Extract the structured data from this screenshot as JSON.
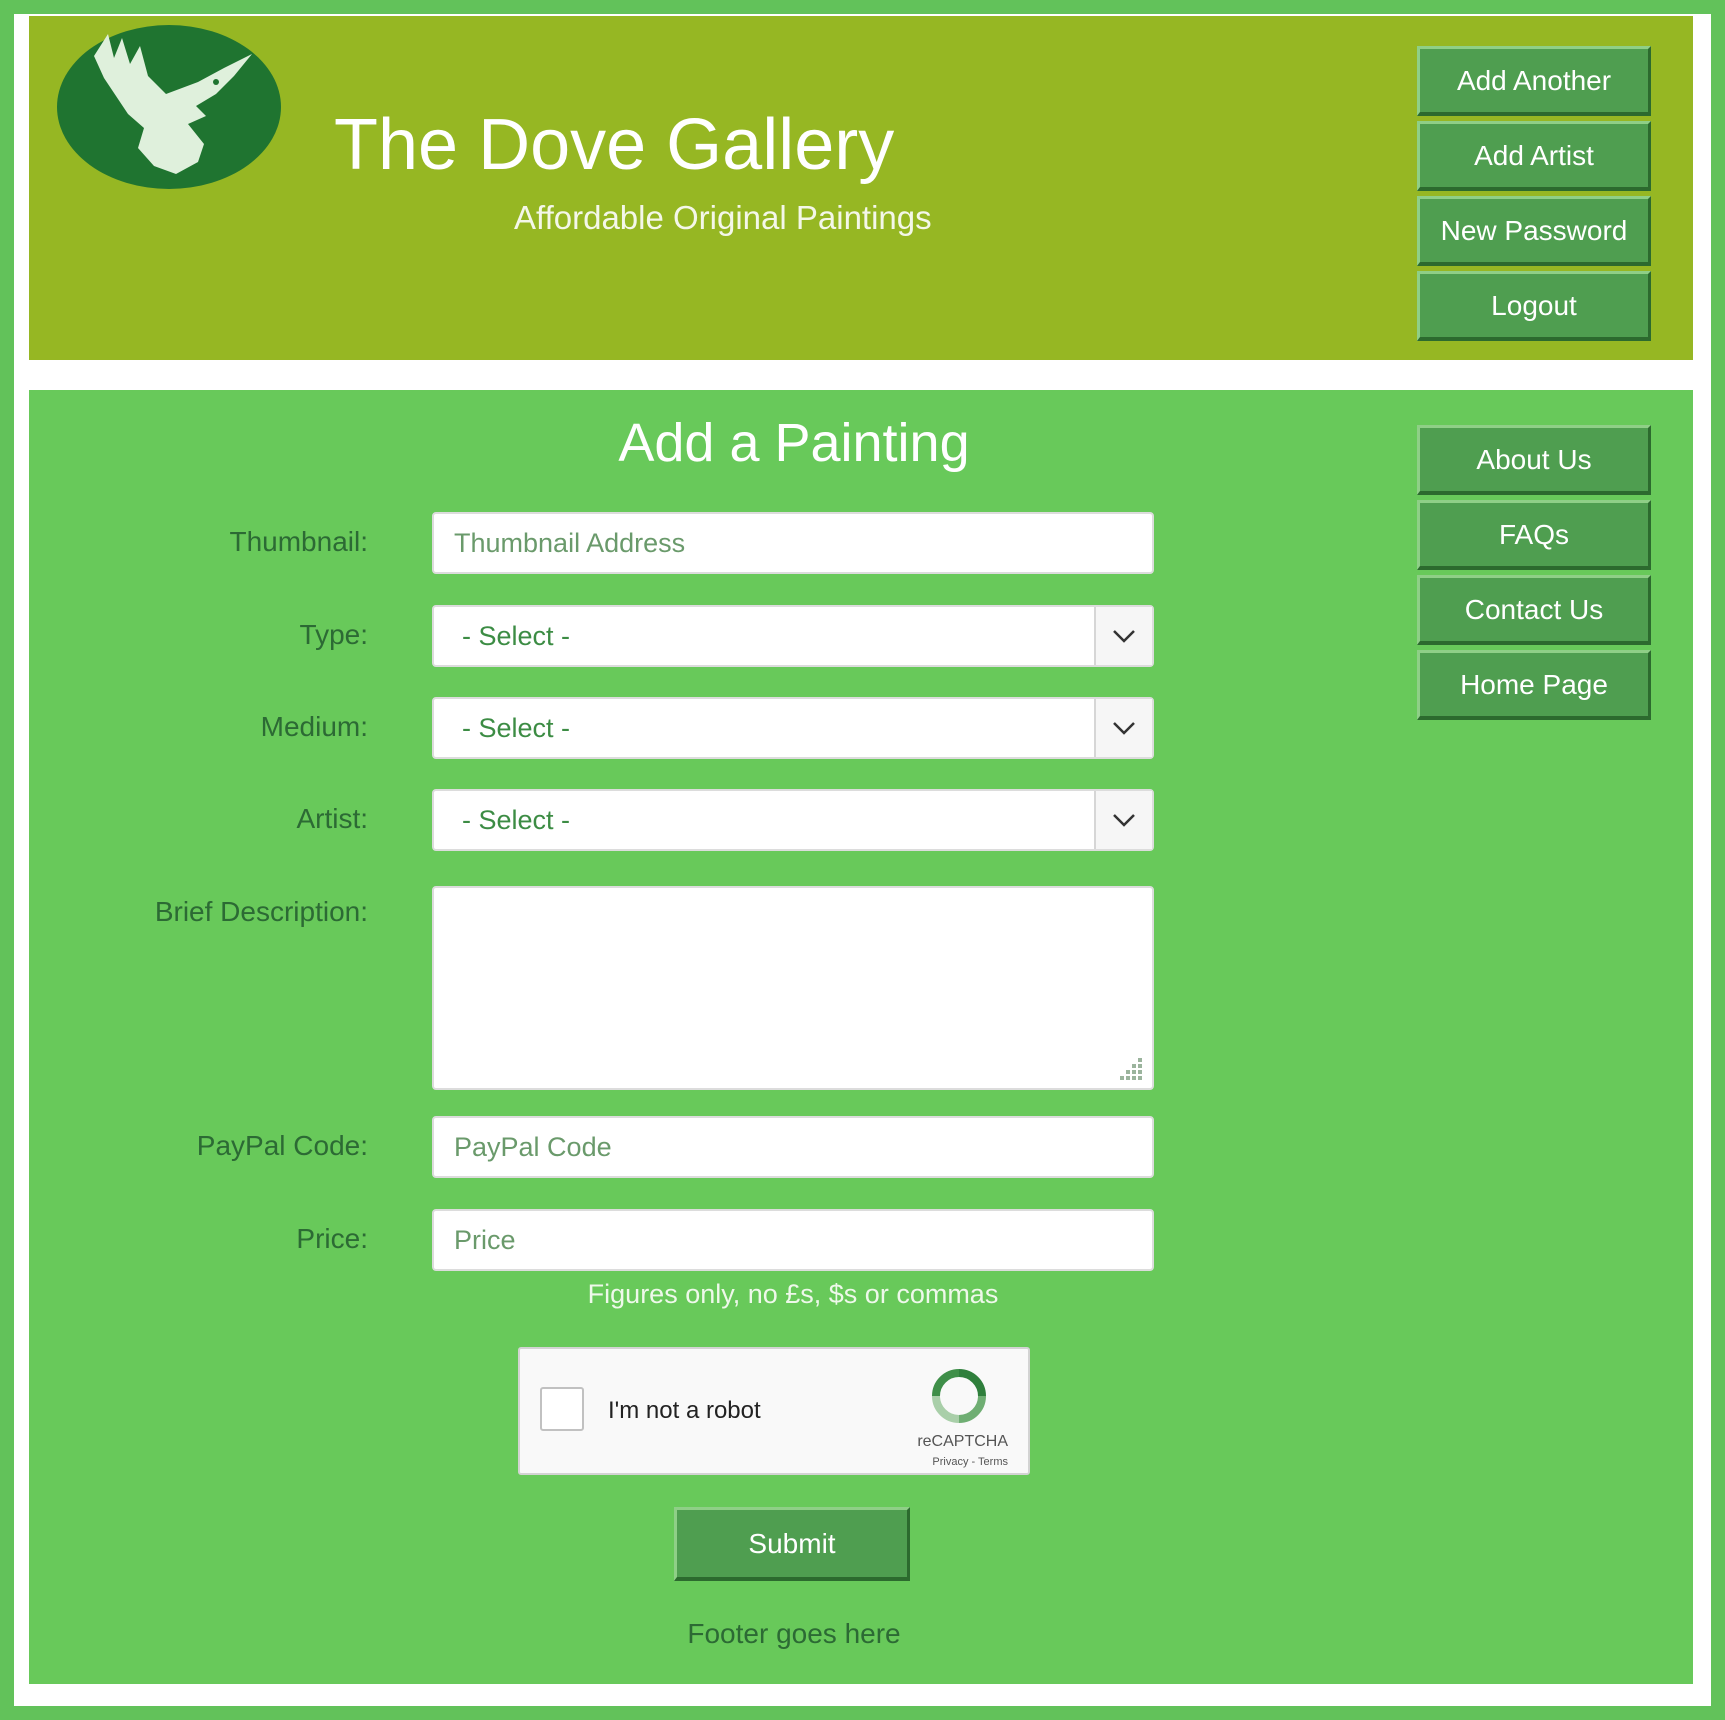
{
  "header": {
    "title": "The Dove Gallery",
    "subtitle": "Affordable Original Paintings",
    "buttons": [
      "Add Another",
      "Add Artist",
      "New Password",
      "Logout"
    ]
  },
  "sidebar": {
    "buttons": [
      "About Us",
      "FAQs",
      "Contact Us",
      "Home Page"
    ]
  },
  "form": {
    "title": "Add a Painting",
    "thumbnail": {
      "label": "Thumbnail:",
      "placeholder": "Thumbnail Address"
    },
    "type": {
      "label": "Type:",
      "selected": "- Select -"
    },
    "medium": {
      "label": "Medium:",
      "selected": "- Select -"
    },
    "artist": {
      "label": "Artist:",
      "selected": "- Select -"
    },
    "description": {
      "label": "Brief Description:",
      "value": ""
    },
    "paypal": {
      "label": "PayPal Code:",
      "placeholder": "PayPal Code"
    },
    "price": {
      "label": "Price:",
      "placeholder": "Price"
    },
    "price_hint": "Figures only, no £s, $s or commas",
    "captcha": {
      "label": "I'm not a robot",
      "brand": "reCAPTCHA",
      "links": "Privacy - Terms"
    },
    "submit_label": "Submit"
  },
  "footer": {
    "text": "Footer goes here"
  },
  "colors": {
    "header_bg": "#96b723",
    "main_bg": "#68c95a",
    "button_bg": "#4f9e50"
  }
}
